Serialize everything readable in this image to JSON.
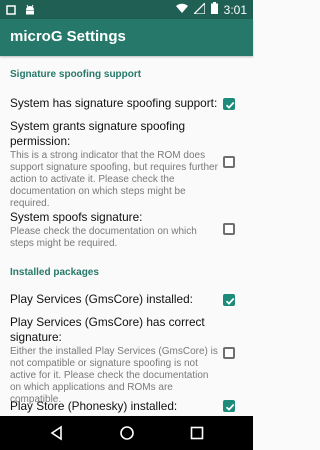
{
  "status_bar": {
    "time": "3:01",
    "icons": [
      "notification-square-icon",
      "android-icon",
      "wifi-icon",
      "no-signal-icon",
      "battery-icon"
    ]
  },
  "app_bar": {
    "title": "microG Settings"
  },
  "sections": {
    "sig": "Signature spoofing support",
    "pkg": "Installed packages"
  },
  "items": [
    {
      "title": "System has signature spoofing support:",
      "summary": "",
      "checked": true
    },
    {
      "title": "System grants signature spoofing permission:",
      "summary": "This is a strong indicator that the ROM does support signature spoofing, but requires further action to activate it. Please check the documentation on which steps might be required.",
      "checked": false
    },
    {
      "title": "System spoofs signature:",
      "summary": "Please check the documentation on which steps might be required.",
      "checked": false
    },
    {
      "title": "Play Services (GmsCore) installed:",
      "summary": "",
      "checked": true
    },
    {
      "title": "Play Services (GmsCore) has correct signature:",
      "summary": "Either the installed Play Services (GmsCore) is not compatible or signature spoofing is not active for it. Please check the documentation on which applications and ROMs are compatible.",
      "checked": false
    },
    {
      "title": "Play Store (Phonesky) installed:",
      "summary": "",
      "checked": true
    }
  ],
  "nav": [
    "back-icon",
    "home-icon",
    "recents-icon"
  ],
  "colors": {
    "accent": "#26796a",
    "status": "#1f5f54",
    "checkbox": "#1e8a7a"
  }
}
